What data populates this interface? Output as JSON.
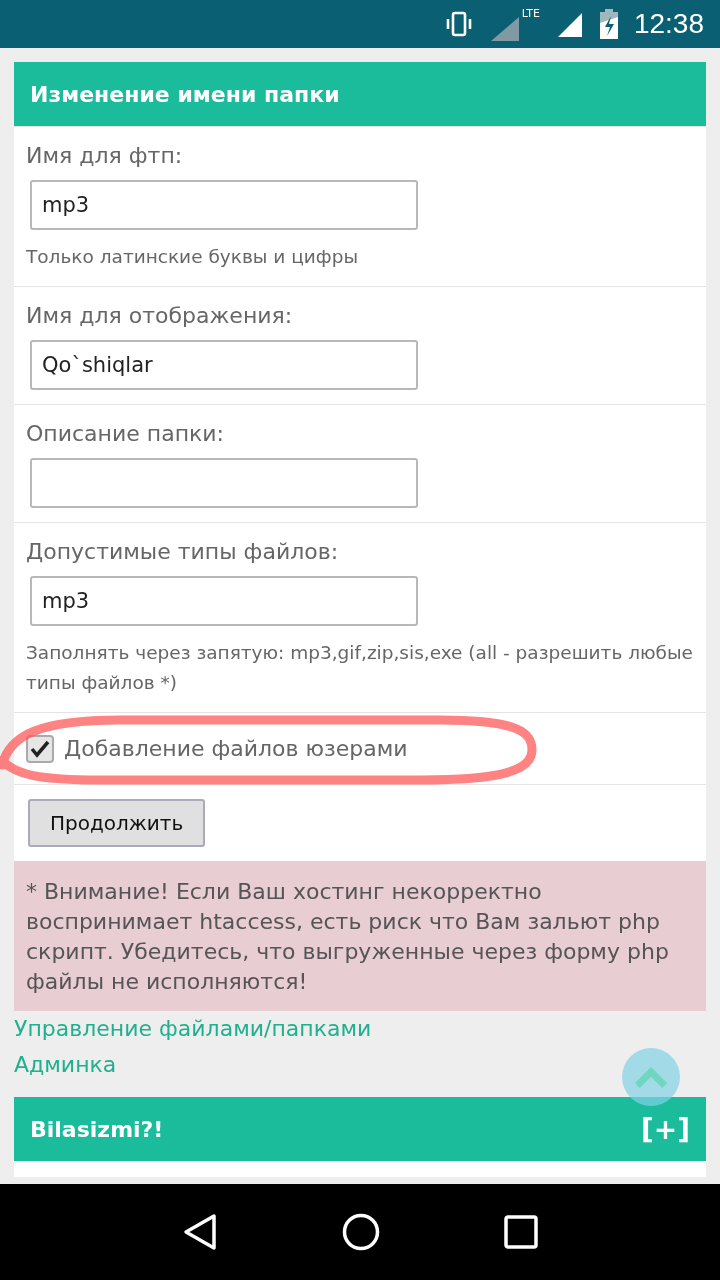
{
  "status_bar": {
    "network": "LTE",
    "time": "12:38"
  },
  "form_panel": {
    "title": "Изменение имени папки",
    "fields": [
      {
        "kind": "text",
        "label": "Имя для фтп:",
        "value": "mp3",
        "hint": "Только латинские буквы и цифры"
      },
      {
        "kind": "text",
        "label": "Имя для отображения:",
        "value": "Qo`shiqlar"
      },
      {
        "kind": "text",
        "label": "Описание папки:"
      },
      {
        "kind": "text",
        "label": "Допустимые типы файлов:",
        "value": "mp3",
        "hint": "Заполнять через запятую: mp3,gif,zip,sis,exe (all - разрешить любые типы файлов *)"
      },
      {
        "kind": "checkbox",
        "label": "Добавление файлов юзерами",
        "checked": true
      },
      {
        "kind": "button",
        "label": "Продолжить"
      }
    ]
  },
  "warning": "* Внимание! Если Ваш хостинг некорректно воспринимает htaccess, есть риск что Вам зальют php скрипт. Убедитесь, что выгруженные через форму php файлы не исполняются!",
  "links": [
    "Управление файлами/папками",
    "Админка"
  ],
  "collapsed_panel": {
    "title": "Bilasizmi?!",
    "toggle": "[+]"
  }
}
